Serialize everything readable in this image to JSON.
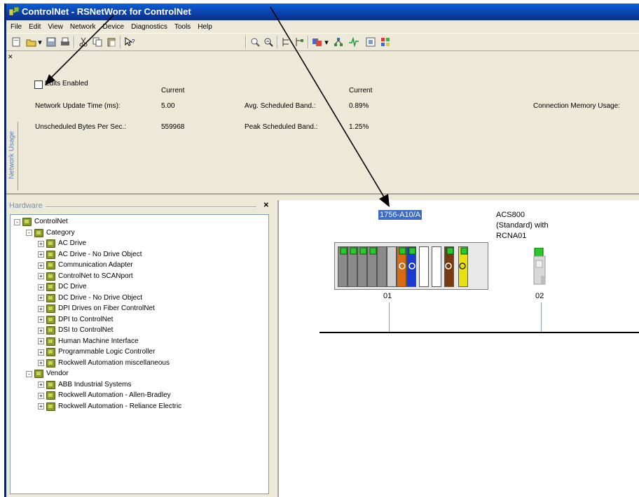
{
  "window": {
    "title": "ControlNet - RSNetWorx for ControlNet"
  },
  "menu": [
    "File",
    "Edit",
    "View",
    "Network",
    "Device",
    "Diagnostics",
    "Tools",
    "Help"
  ],
  "toolbar": {
    "icons": [
      "new-icon",
      "open-icon",
      "save-icon",
      "print-icon",
      "cut-icon",
      "copy-icon",
      "paste-icon",
      "help-pointer-icon",
      "zoom-in-icon",
      "zoom-out-icon",
      "single-pass-browse-icon",
      "continuous-browse-icon",
      "upload-download-icon",
      "network-icon",
      "graph-icon",
      "properties-icon",
      "hardware-icon"
    ]
  },
  "network_usage": {
    "tab_label": "Network Usage",
    "edits_enabled": {
      "label": "Edits Enabled",
      "checked": false
    },
    "current_header_left": "Current",
    "current_header_right": "Current",
    "update_time_label": "Network Update Time (ms):",
    "update_time_value": "5.00",
    "unscheduled_label": "Unscheduled Bytes Per Sec.:",
    "unscheduled_value": "559968",
    "avg_band_label": "Avg. Scheduled Band.:",
    "avg_band_value": "0.89%",
    "peak_band_label": "Peak Scheduled Band.:",
    "peak_band_value": "1.25%",
    "connection_memory_label": "Connection Memory Usage:"
  },
  "hardware": {
    "title": "Hardware",
    "tree": [
      {
        "label": "ControlNet",
        "level": 0,
        "expander": "-"
      },
      {
        "label": "Category",
        "level": 1,
        "expander": "-"
      },
      {
        "label": "AC Drive",
        "level": 2,
        "expander": "+"
      },
      {
        "label": "AC Drive - No Drive Object",
        "level": 2,
        "expander": "+"
      },
      {
        "label": "Communication Adapter",
        "level": 2,
        "expander": "+"
      },
      {
        "label": "ControlNet to SCANport",
        "level": 2,
        "expander": "+"
      },
      {
        "label": "DC Drive",
        "level": 2,
        "expander": "+"
      },
      {
        "label": "DC Drive - No Drive Object",
        "level": 2,
        "expander": "+"
      },
      {
        "label": "DPI Drives on Fiber ControlNet",
        "level": 2,
        "expander": "+"
      },
      {
        "label": "DPI to ControlNet",
        "level": 2,
        "expander": "+"
      },
      {
        "label": "DSI to ControlNet",
        "level": 2,
        "expander": "+"
      },
      {
        "label": "Human Machine Interface",
        "level": 2,
        "expander": "+"
      },
      {
        "label": "Programmable Logic Controller",
        "level": 2,
        "expander": "+"
      },
      {
        "label": "Rockwell Automation miscellaneous",
        "level": 2,
        "expander": "+"
      },
      {
        "label": "Vendor",
        "level": 1,
        "expander": "-"
      },
      {
        "label": "ABB Industrial Systems",
        "level": 2,
        "expander": "+"
      },
      {
        "label": "Rockwell Automation - Allen-Bradley",
        "level": 2,
        "expander": "+"
      },
      {
        "label": "Rockwell Automation - Reliance Electric",
        "level": 2,
        "expander": "+"
      }
    ]
  },
  "network_view": {
    "node1": {
      "label": "1756-A10/A",
      "address": "01"
    },
    "node2": {
      "label_lines": [
        "ACS800",
        "(Standard) with",
        "RCNA01"
      ],
      "address": "02"
    },
    "colors": {
      "selection": "#3d6cc2",
      "bus": "#000000",
      "drop": "#7fa0c8"
    }
  }
}
